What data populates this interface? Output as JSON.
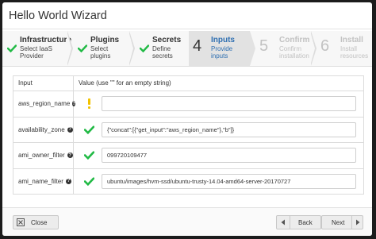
{
  "modal": {
    "title": "Hello World Wizard"
  },
  "steps": [
    {
      "number": "",
      "title": "Infrastructure",
      "subtitle": "Select IaaS Provider",
      "state": "done",
      "icon": "check-icon"
    },
    {
      "number": "",
      "title": "Plugins",
      "subtitle": "Select plugins",
      "state": "done",
      "icon": "check-icon"
    },
    {
      "number": "",
      "title": "Secrets",
      "subtitle": "Define secrets",
      "state": "done",
      "icon": "check-icon"
    },
    {
      "number": "4",
      "title": "Inputs",
      "subtitle": "Provide inputs",
      "state": "active"
    },
    {
      "number": "5",
      "title": "Confirm",
      "subtitle": "Confirm installation",
      "state": "future"
    },
    {
      "number": "6",
      "title": "Install",
      "subtitle": "Install resources",
      "state": "future"
    }
  ],
  "table": {
    "header": {
      "input": "Input",
      "value": "Value (use \"\" for an empty string)"
    },
    "rows": [
      {
        "name": "aws_region_name",
        "status": "warning",
        "value": ""
      },
      {
        "name": "availability_zone",
        "status": "ok",
        "value": "{\"concat\":[{\"get_input\":\"aws_region_name\"},\"b\"]}"
      },
      {
        "name": "ami_owner_filter",
        "status": "ok",
        "value": "099720109477"
      },
      {
        "name": "ami_name_filter",
        "status": "ok",
        "value": "ubuntu/images/hvm-ssd/ubuntu-trusty-14.04-amd64-server-20170727"
      }
    ]
  },
  "footer": {
    "close_label": "Close",
    "back_label": "Back",
    "next_label": "Next"
  },
  "colors": {
    "check": "#21ba45",
    "warning": "#f2c200",
    "active_text": "#2f6fb1"
  }
}
